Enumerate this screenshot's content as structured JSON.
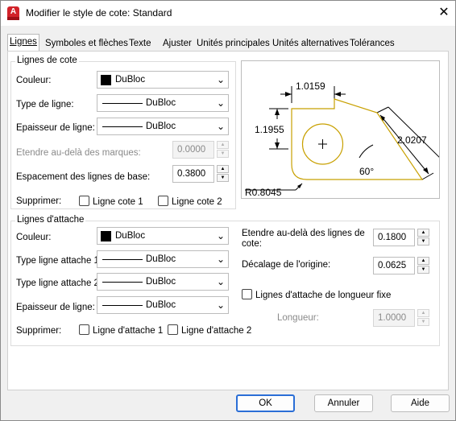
{
  "window": {
    "title": "Modifier le style de cote: Standard",
    "app_icon_letter": "A",
    "close_glyph": "✕"
  },
  "tabs": [
    "Lignes",
    "Symboles et flèches",
    "Texte",
    "Ajuster",
    "Unités principales",
    "Unités alternatives",
    "Tolérances"
  ],
  "dim_lines": {
    "title": "Lignes de cote",
    "color_label": "Couleur:",
    "color_value": "DuBloc",
    "linetype_label": "Type de ligne:",
    "linetype_value": "DuBloc",
    "lineweight_label": "Epaisseur de ligne:",
    "lineweight_value": "DuBloc",
    "extend_label": "Etendre au-delà des marques:",
    "extend_value": "0.0000",
    "baseline_label": "Espacement des lignes de base:",
    "baseline_value": "0.3800",
    "suppress_label": "Supprimer:",
    "suppress_1": "Ligne cote 1",
    "suppress_2": "Ligne cote 2"
  },
  "ext_lines": {
    "title": "Lignes d'attache",
    "color_label": "Couleur:",
    "color_value": "DuBloc",
    "lt1_label": "Type ligne attache 1:",
    "lt1_value": "DuBloc",
    "lt2_label": "Type ligne attache 2:",
    "lt2_value": "DuBloc",
    "lw_label": "Epaisseur de ligne:",
    "lw_value": "DuBloc",
    "suppress_label": "Supprimer:",
    "suppress_1": "Ligne d'attache 1",
    "suppress_2": "Ligne d'attache 2",
    "extend_label": "Etendre au-delà des lignes de cote:",
    "extend_value": "0.1800",
    "offset_label": "Décalage de l'origine:",
    "offset_value": "0.0625",
    "fixed_label": "Lignes d'attache de longueur fixe",
    "length_label": "Longueur:",
    "length_value": "1.0000"
  },
  "preview": {
    "dim_top": "1.0159",
    "dim_left": "1.1955",
    "dim_right": "2.0207",
    "angle": "60°",
    "radius": "R0.8045"
  },
  "buttons": {
    "ok": "OK",
    "cancel": "Annuler",
    "help": "Aide"
  },
  "colors": {
    "accent": "#2a6ed6",
    "shape": "#c8a000",
    "app_icon": "#d2232a"
  }
}
